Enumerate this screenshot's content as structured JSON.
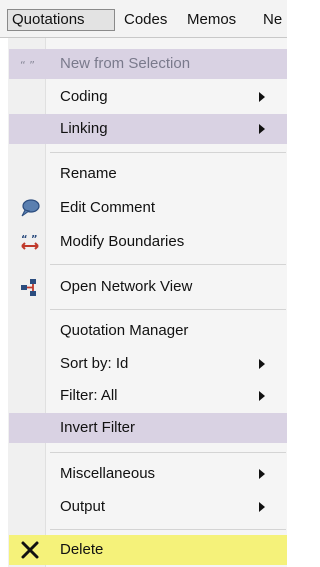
{
  "menubar": {
    "items": [
      "Quotations",
      "Codes",
      "Memos",
      "Ne"
    ]
  },
  "menu": {
    "items": [
      {
        "label": "New from Selection",
        "icon": "quote-marks-icon",
        "submenu": false,
        "disabled": true
      },
      {
        "label": "Coding",
        "submenu": true
      },
      {
        "label": "Linking",
        "submenu": true
      },
      {
        "label": "Rename",
        "submenu": false
      },
      {
        "label": "Edit Comment",
        "icon": "speech-bubble-icon",
        "submenu": false
      },
      {
        "label": "Modify Boundaries",
        "icon": "boundaries-icon",
        "submenu": false
      },
      {
        "label": "Open Network View",
        "icon": "network-icon",
        "submenu": false
      },
      {
        "label": "Quotation Manager",
        "submenu": false
      },
      {
        "label": "Sort by: Id",
        "submenu": true
      },
      {
        "label": "Filter: All",
        "submenu": true
      },
      {
        "label": "Invert Filter",
        "submenu": false
      },
      {
        "label": "Miscellaneous",
        "submenu": true
      },
      {
        "label": "Output",
        "submenu": true
      },
      {
        "label": "Delete",
        "icon": "x-delete-icon",
        "submenu": false
      }
    ]
  },
  "colors": {
    "highlight": "#d9d2e3",
    "delete_highlight": "#f5f27a",
    "icon_red": "#c0392b",
    "icon_blue": "#2b4c7e"
  }
}
